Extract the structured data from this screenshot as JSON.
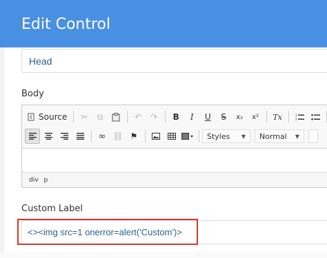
{
  "header": {
    "title": "Edit Control"
  },
  "head_field": {
    "value": "Head"
  },
  "body_section": {
    "label": "Body"
  },
  "editor": {
    "toolbar_row1": {
      "source_label": "Source",
      "bold": "B",
      "italic": "I",
      "underline": "U",
      "strike": "S",
      "subscript": "x₂",
      "superscript": "x²",
      "remove_format": "Tx"
    },
    "toolbar_row2": {
      "styles_label": "Styles",
      "format_label": "Normal"
    },
    "path": [
      "div",
      "p"
    ]
  },
  "custom_label": {
    "label": "Custom Label",
    "value": "<><img src=1 onerror=alert('Custom')>"
  },
  "colors": {
    "header_bg": "#4a90e2",
    "highlight": "#d9342b",
    "value_text": "#2b5f8f"
  }
}
